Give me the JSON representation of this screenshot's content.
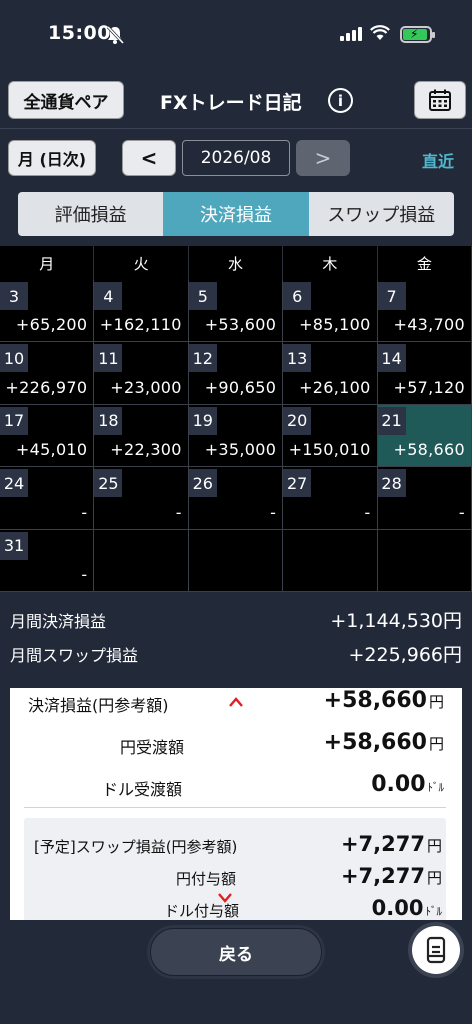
{
  "status": {
    "time": "15:00"
  },
  "header": {
    "pair_button": "全通貨ペア",
    "title": "FXトレード日記",
    "info_icon": "i"
  },
  "nav": {
    "mode": "月 (日次)",
    "prev": "<",
    "date": "2026/08",
    "next": ">",
    "recent": "直近"
  },
  "tabs": [
    {
      "label": "評価損益",
      "active": false
    },
    {
      "label": "決済損益",
      "active": true
    },
    {
      "label": "スワップ損益",
      "active": false
    }
  ],
  "weekdays": [
    "月",
    "火",
    "水",
    "木",
    "金"
  ],
  "calendar": [
    {
      "day": "3",
      "value": "+65,200"
    },
    {
      "day": "4",
      "value": "+162,110"
    },
    {
      "day": "5",
      "value": "+53,600"
    },
    {
      "day": "6",
      "value": "+85,100"
    },
    {
      "day": "7",
      "value": "+43,700"
    },
    {
      "day": "10",
      "value": "+226,970"
    },
    {
      "day": "11",
      "value": "+23,000"
    },
    {
      "day": "12",
      "value": "+90,650"
    },
    {
      "day": "13",
      "value": "+26,100"
    },
    {
      "day": "14",
      "value": "+57,120"
    },
    {
      "day": "17",
      "value": "+45,010"
    },
    {
      "day": "18",
      "value": "+22,300"
    },
    {
      "day": "19",
      "value": "+35,000"
    },
    {
      "day": "20",
      "value": "+150,010"
    },
    {
      "day": "21",
      "value": "+58,660",
      "selected": true
    },
    {
      "day": "24",
      "value": "-"
    },
    {
      "day": "25",
      "value": "-"
    },
    {
      "day": "26",
      "value": "-"
    },
    {
      "day": "27",
      "value": "-"
    },
    {
      "day": "28",
      "value": "-"
    },
    {
      "day": "31",
      "value": "-"
    },
    {
      "day": "",
      "value": ""
    },
    {
      "day": "",
      "value": ""
    },
    {
      "day": "",
      "value": ""
    },
    {
      "day": "",
      "value": ""
    }
  ],
  "summary": {
    "settle_label": "月間決済損益",
    "settle_value": "+1,144,530円",
    "swap_label": "月間スワップ損益",
    "swap_value": "+225,966円"
  },
  "detail": {
    "settle_label": "決済損益(円参考額)",
    "settle_value": "+58,660",
    "yen_unit": "円",
    "yen_recv_label": "円受渡額",
    "yen_recv_value": "+58,660",
    "usd_recv_label": "ドル受渡額",
    "usd_recv_value": "0.00",
    "usd_unit": "ﾄﾞﾙ",
    "swap_label": "[予定]スワップ損益(円参考額)",
    "swap_value": "+7,277",
    "yen_grant_label": "円付与額",
    "yen_grant_value": "+7,277",
    "usd_grant_label": "ドル付与額",
    "usd_grant_value": "0.00"
  },
  "footer": {
    "back": "戻る"
  },
  "colors": {
    "accent": "#4ea7bd",
    "selected_cell": "#1f5a58",
    "link": "#4fb8cc",
    "chevron": "#e02020"
  }
}
